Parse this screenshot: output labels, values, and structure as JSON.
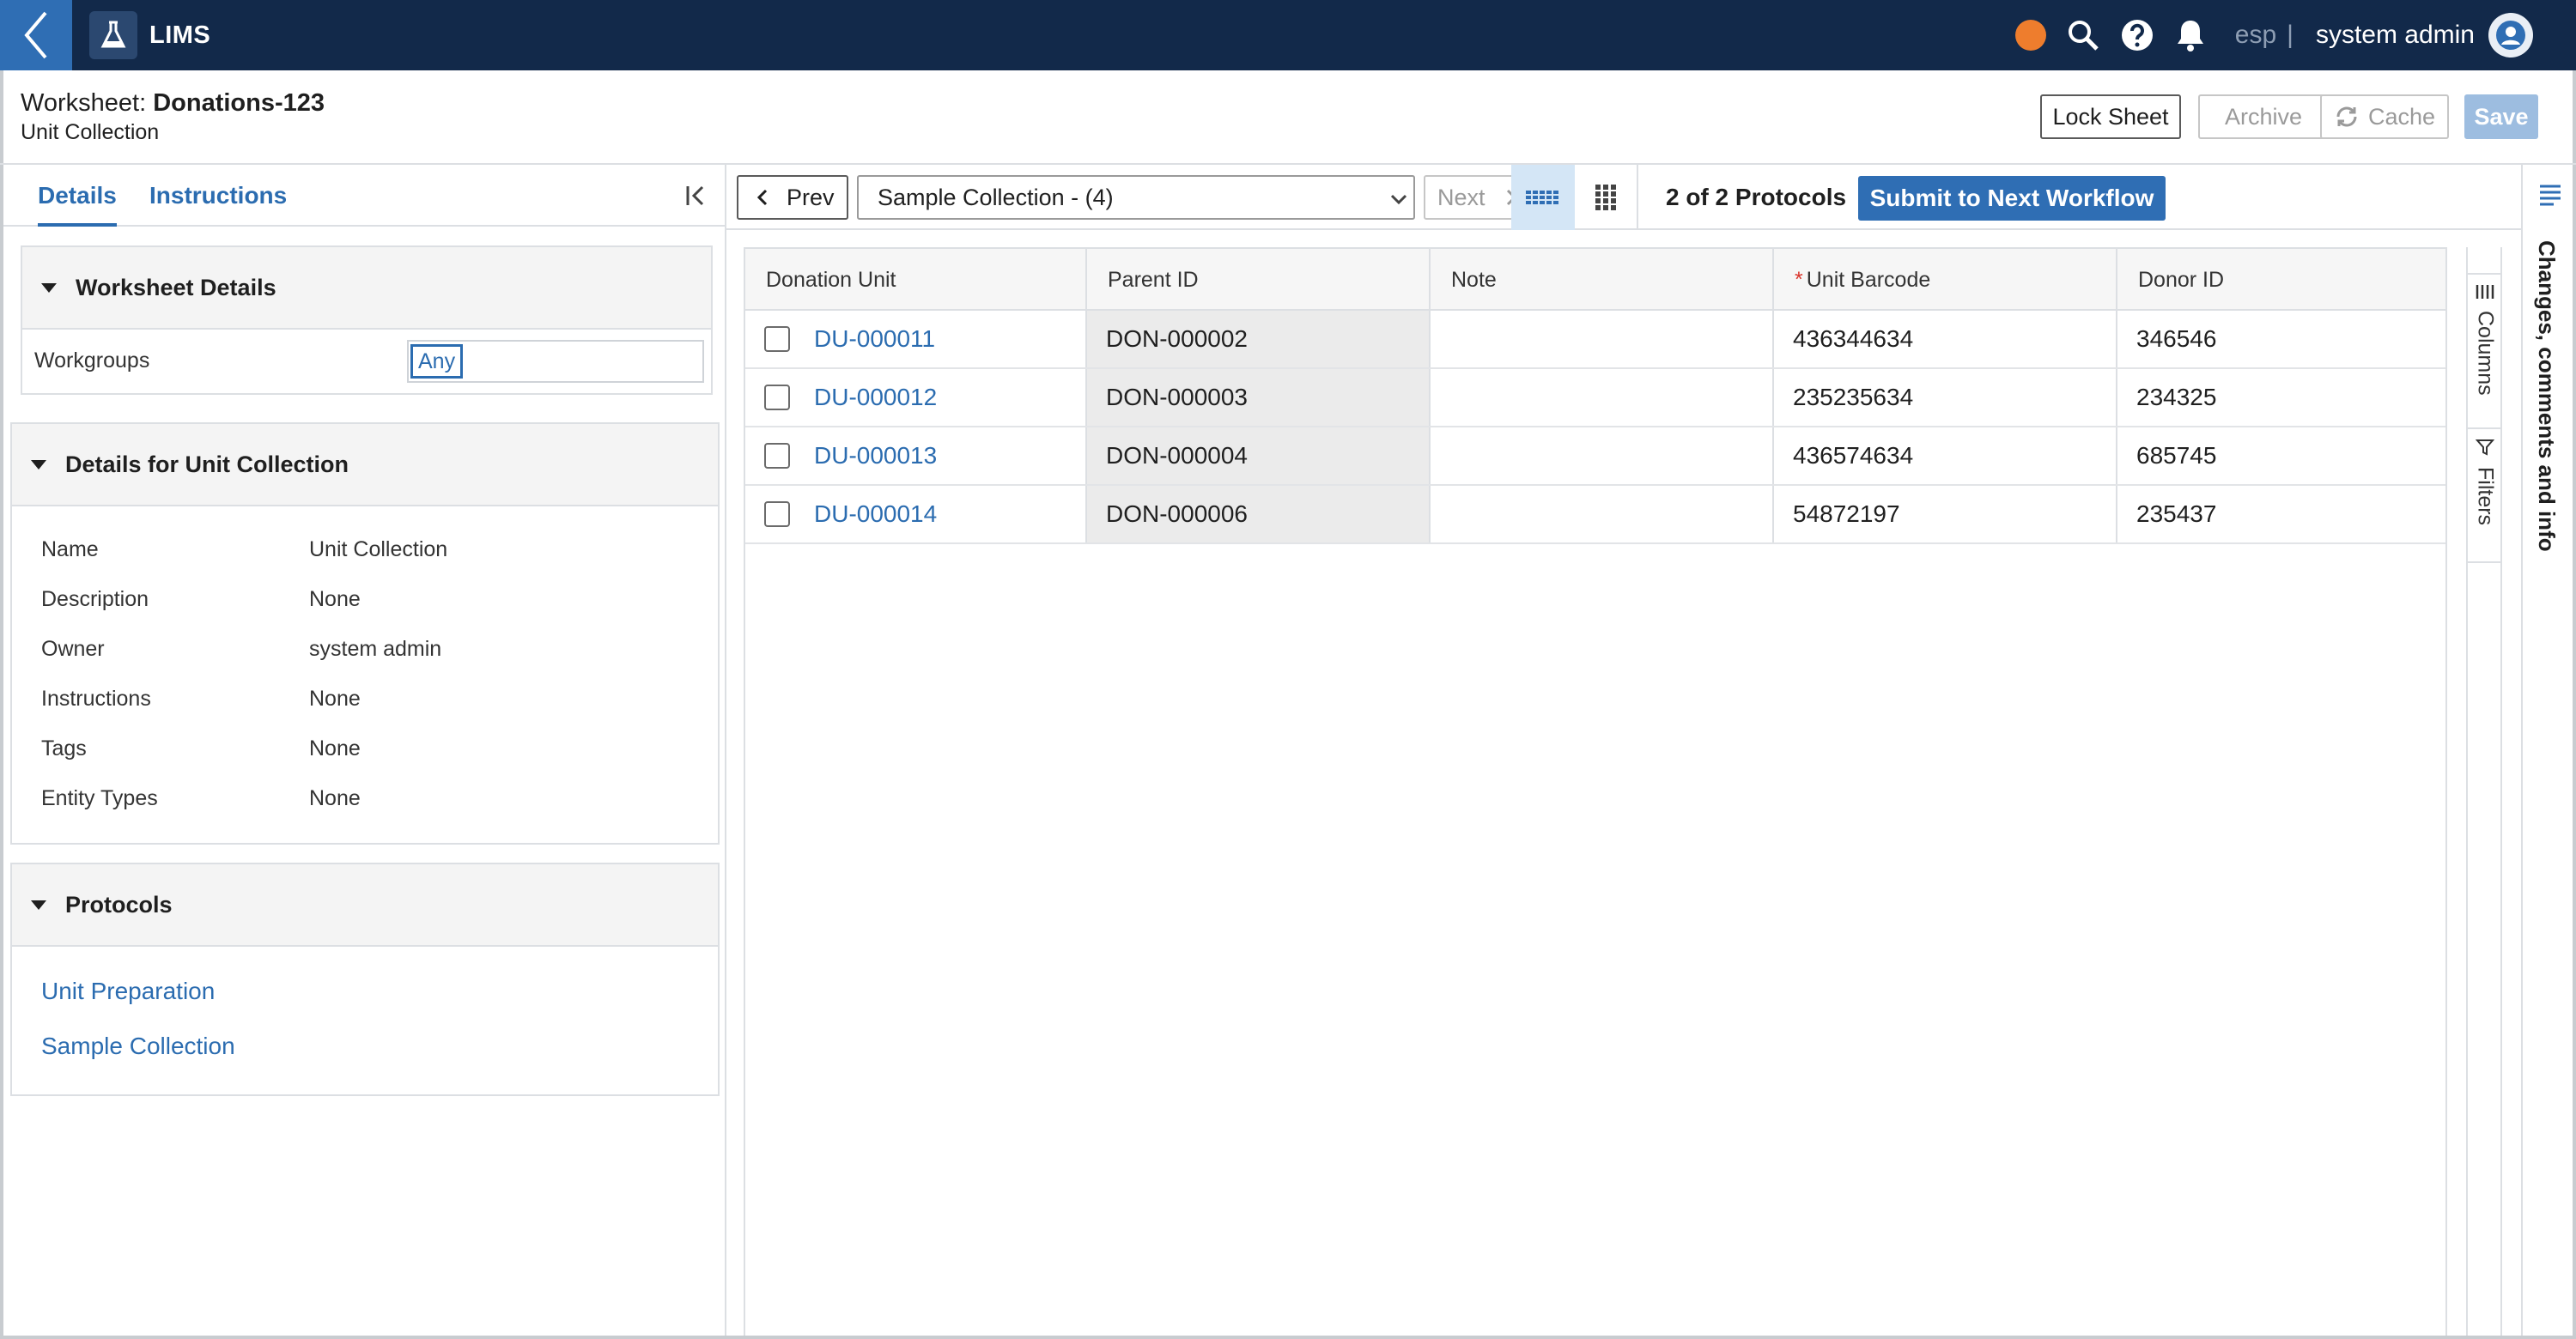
{
  "topbar": {
    "app_name": "LIMS",
    "language": "esp",
    "separator": "|",
    "user_name": "system admin",
    "status_color": "#ee7d2d",
    "icons": [
      "back-chevron-icon",
      "flask-icon",
      "search-icon",
      "help-icon",
      "bell-icon",
      "user-avatar-icon"
    ]
  },
  "header": {
    "title_prefix": "Worksheet:",
    "title_name": "Donations-123",
    "subtitle": "Unit Collection",
    "buttons": {
      "lock": "Lock Sheet",
      "archive": "Archive",
      "cache": "Cache",
      "save": "Save"
    }
  },
  "left_panel": {
    "tabs": {
      "details": "Details",
      "instructions": "Instructions"
    },
    "worksheet_details": {
      "title": "Worksheet Details",
      "workgroups_label": "Workgroups",
      "workgroups_value": "Any"
    },
    "unit_details": {
      "title": "Details for Unit Collection",
      "rows": [
        {
          "label": "Name",
          "value": "Unit Collection"
        },
        {
          "label": "Description",
          "value": "None"
        },
        {
          "label": "Owner",
          "value": "system admin"
        },
        {
          "label": "Instructions",
          "value": "None"
        },
        {
          "label": "Tags",
          "value": "None"
        },
        {
          "label": "Entity Types",
          "value": "None"
        }
      ]
    },
    "protocols": {
      "title": "Protocols",
      "items": [
        "Unit Preparation",
        "Sample Collection"
      ]
    }
  },
  "toolbar": {
    "prev": "Prev",
    "protocol_select": "Sample Collection - (4)",
    "next": "Next",
    "protocol_count": "2 of 2 Protocols",
    "submit": "Submit to Next Workflow"
  },
  "grid": {
    "columns": [
      "Donation Unit",
      "Parent ID",
      "Note",
      "Unit Barcode",
      "Donor ID"
    ],
    "required_marker": "*",
    "rows": [
      {
        "donation_unit": "DU-000011",
        "parent_id": "DON-000002",
        "note": "",
        "unit_barcode": "436344634",
        "donor_id": "346546"
      },
      {
        "donation_unit": "DU-000012",
        "parent_id": "DON-000003",
        "note": "",
        "unit_barcode": "235235634",
        "donor_id": "234325"
      },
      {
        "donation_unit": "DU-000013",
        "parent_id": "DON-000004",
        "note": "",
        "unit_barcode": "436574634",
        "donor_id": "685745"
      },
      {
        "donation_unit": "DU-000014",
        "parent_id": "DON-000006",
        "note": "",
        "unit_barcode": "54872197",
        "donor_id": "235437"
      }
    ]
  },
  "side_tools": {
    "columns": "Columns",
    "filters": "Filters"
  },
  "right_rail": {
    "label": "Changes, comments and info"
  }
}
